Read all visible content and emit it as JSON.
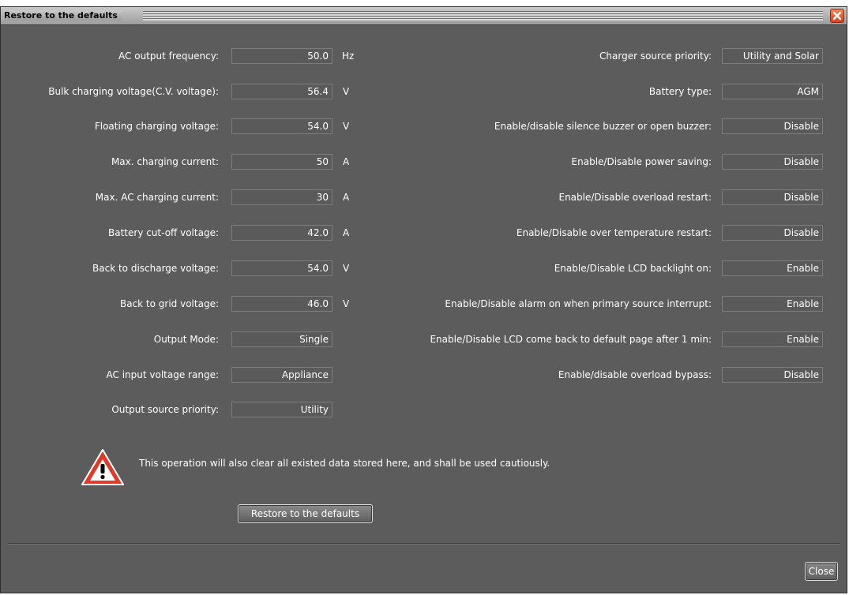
{
  "window": {
    "title": "Restore to the defaults"
  },
  "left_fields": [
    {
      "label": "AC output frequency:",
      "value": "50.0",
      "unit": "Hz"
    },
    {
      "label": "Bulk charging voltage(C.V. voltage):",
      "value": "56.4",
      "unit": "V"
    },
    {
      "label": "Floating charging voltage:",
      "value": "54.0",
      "unit": "V"
    },
    {
      "label": "Max. charging current:",
      "value": "50",
      "unit": "A"
    },
    {
      "label": "Max. AC charging current:",
      "value": "30",
      "unit": "A"
    },
    {
      "label": "Battery cut-off voltage:",
      "value": "42.0",
      "unit": "A"
    },
    {
      "label": "Back to discharge voltage:",
      "value": "54.0",
      "unit": "V"
    },
    {
      "label": "Back to grid voltage:",
      "value": "46.0",
      "unit": "V"
    },
    {
      "label": "Output Mode:",
      "value": "Single",
      "unit": ""
    },
    {
      "label": "AC input voltage range:",
      "value": "Appliance",
      "unit": ""
    },
    {
      "label": "Output source priority:",
      "value": "Utility",
      "unit": ""
    }
  ],
  "right_fields": [
    {
      "label": "Charger source priority:",
      "value": "Utility and Solar"
    },
    {
      "label": "Battery type:",
      "value": "AGM"
    },
    {
      "label": "Enable/disable silence buzzer or open buzzer:",
      "value": "Disable"
    },
    {
      "label": "Enable/Disable power saving:",
      "value": "Disable"
    },
    {
      "label": "Enable/Disable overload restart:",
      "value": "Disable"
    },
    {
      "label": "Enable/Disable over temperature restart:",
      "value": "Disable"
    },
    {
      "label": "Enable/Disable LCD backlight on:",
      "value": "Enable"
    },
    {
      "label": "Enable/Disable alarm on when primary source interrupt:",
      "value": "Enable"
    },
    {
      "label": "Enable/Disable LCD come back to default page after 1 min:",
      "value": "Enable"
    },
    {
      "label": "Enable/disable overload bypass:",
      "value": "Disable"
    }
  ],
  "warning": {
    "icon": "warning-triangle-icon",
    "text": "This operation will also clear all existed data stored here, and shall be used cautiously."
  },
  "buttons": {
    "restore_label": "Restore to the defaults",
    "close_label": "Close"
  },
  "colors": {
    "background": "#5c5c5c",
    "warning_red": "#e03a2a",
    "close_orange": "#e4552c"
  }
}
